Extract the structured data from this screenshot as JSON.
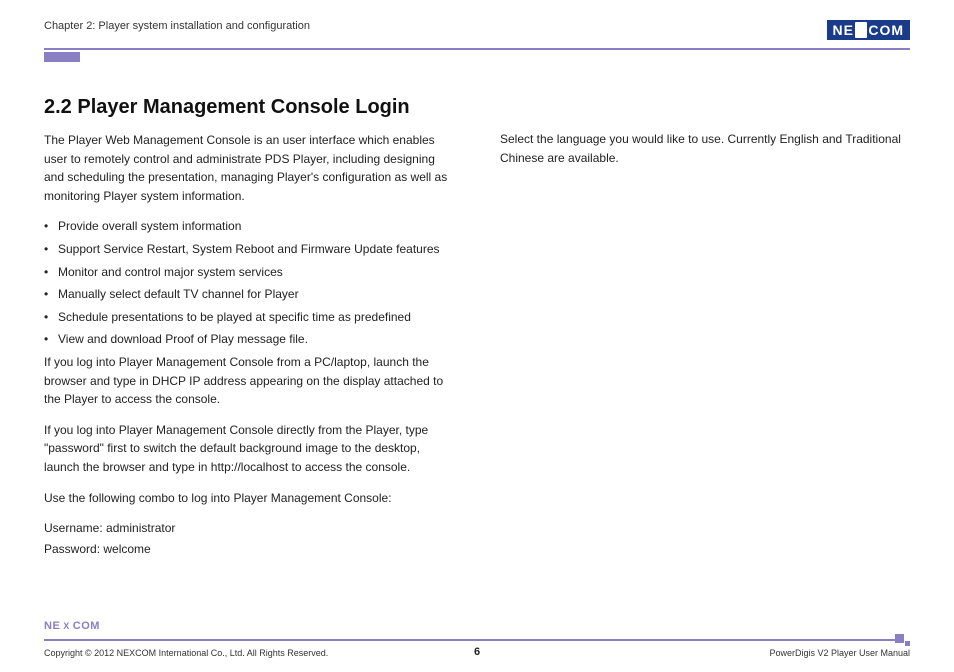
{
  "header": {
    "chapter": "Chapter 2: Player system installation and configuration",
    "logo_left": "NE",
    "logo_x": "X",
    "logo_right": "COM"
  },
  "main": {
    "heading": "2.2 Player Management Console Login",
    "intro": "The Player Web Management Console is an user interface which enables user to remotely control and administrate PDS Player, including designing and scheduling the presentation, managing Player's configuration as well as monitoring Player system information.",
    "bullets": [
      "Provide overall system information",
      "Support Service Restart, System Reboot and Firmware Update features",
      "Monitor and control major system services",
      "Manually select default TV channel for Player",
      "Schedule presentations to be played at specific time as predefined",
      "View and download Proof of Play message file."
    ],
    "para_pc": "If you log into Player Management Console from a PC/laptop, launch the browser and type in DHCP IP address appearing on the display attached to the Player to access the console.",
    "para_direct": "If you log into Player Management Console directly from the Player, type \"password\" first to switch the default background image to the desktop, launch the browser and type in http://localhost to access the console.",
    "para_combo": "Use the following combo to log into Player Management Console:",
    "cred_user": "Username: administrator",
    "cred_pass": "Password: welcome",
    "col2": "Select the language you would like to use. Currently English and Traditional Chinese are available."
  },
  "footer": {
    "logo_left": "NE",
    "logo_x": "X",
    "logo_right": "COM",
    "copyright": "Copyright © 2012 NEXCOM International Co., Ltd. All Rights Reserved.",
    "page": "6",
    "manual": "PowerDigis V2 Player User Manual"
  }
}
